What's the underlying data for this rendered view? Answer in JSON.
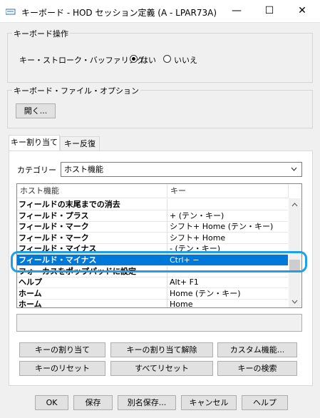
{
  "window": {
    "title": "キーボード - HOD セッション定義 (A - LPAR73A)",
    "minimize_glyph": "—",
    "maximize_glyph": "☐",
    "close_glyph": "✕"
  },
  "keyboard_ops": {
    "legend": "キーボード操作",
    "buffering_label": "キー・ストローク・バッファリング:",
    "yes_label": "はい",
    "no_label": "いいえ",
    "selected": "はい"
  },
  "file_options": {
    "legend": "キーボード・ファイル・オプション",
    "open_button": "開く..."
  },
  "tabs": [
    {
      "label": "キー割り当て",
      "active": true
    },
    {
      "label": "キー反復",
      "active": false
    }
  ],
  "category": {
    "label": "カテゴリー",
    "value": "ホスト機能"
  },
  "table": {
    "columns": [
      "ホスト機能",
      "キー"
    ],
    "rows": [
      {
        "func": "フィールドの末尾までの消去",
        "key": ""
      },
      {
        "func": "フィールド・プラス",
        "key": "+ (テン・キー)"
      },
      {
        "func": "フィールド・マーク",
        "key": "シフト+ Home (テン・キー)"
      },
      {
        "func": "フィールド・マーク",
        "key": "シフト+ Home"
      },
      {
        "func": "フィールド・マイナス",
        "key": "- (テン・キー)"
      },
      {
        "func": "フィールド・マイナス",
        "key": "Ctrl+ −",
        "selected": true
      },
      {
        "func": "フォーカスをポップパッドに設定",
        "key": ""
      },
      {
        "func": "ヘルプ",
        "key": "Alt+ F1"
      },
      {
        "func": "ホーム",
        "key": "Home (テン・キー)"
      },
      {
        "func": "ホーム",
        "key": "Home"
      }
    ]
  },
  "action_buttons": {
    "assign": "キーの割り当て",
    "unassign": "キーの割り当て解除",
    "custom": "カスタム機能...",
    "reset_key": "キーのリセット",
    "reset_all": "すべてリセット",
    "search": "キーの検索"
  },
  "footer_buttons": {
    "ok": "OK",
    "save": "保存",
    "save_as": "別名保存...",
    "cancel": "キャンセル",
    "help": "ヘルプ"
  },
  "colors": {
    "selection": "#0078d7",
    "callout": "#1fa0e6"
  }
}
